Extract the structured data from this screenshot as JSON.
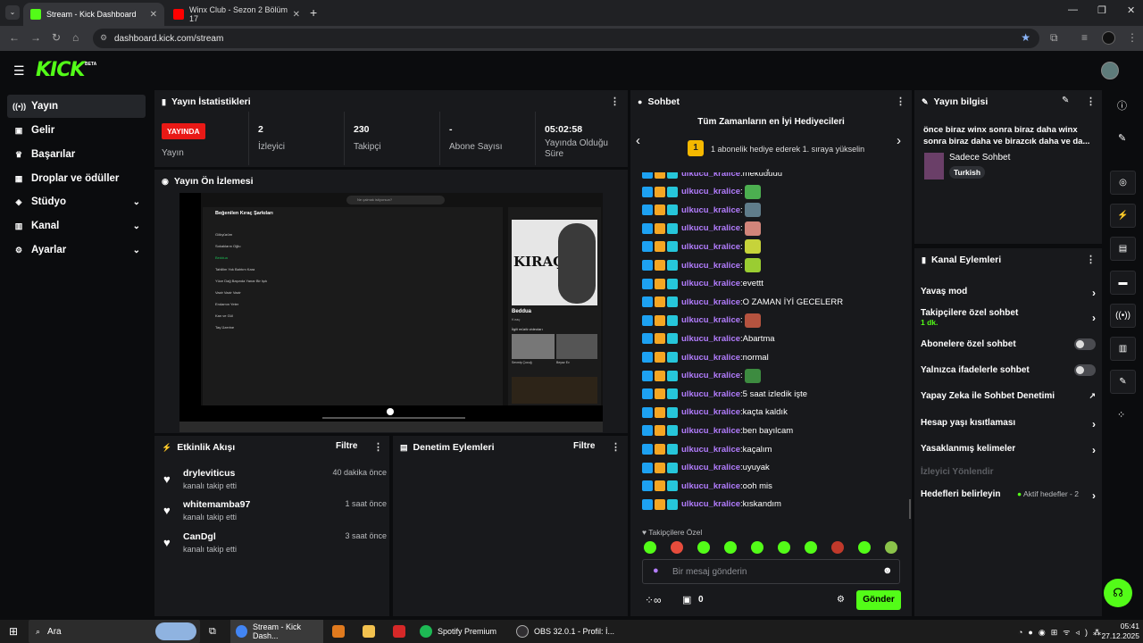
{
  "browser": {
    "tabs": [
      {
        "label": "Stream - Kick Dashboard",
        "favicon_color": "#53fc18"
      },
      {
        "label": "Winx Club - Sezon 2 Bölüm 17",
        "favicon_color": "#ff0000"
      }
    ],
    "url": "dashboard.kick.com/stream"
  },
  "logo": {
    "text": "KICK",
    "badge": "BETA"
  },
  "sidebar": {
    "items": [
      {
        "label": "Yayın",
        "icon": "broadcast-icon",
        "glyph": "((•))",
        "active": true,
        "expandable": false
      },
      {
        "label": "Gelir",
        "icon": "revenue-icon",
        "glyph": "▣",
        "active": false,
        "expandable": false
      },
      {
        "label": "Başarılar",
        "icon": "trophy-icon",
        "glyph": "🏆",
        "active": false,
        "expandable": false
      },
      {
        "label": "Droplar ve ödüller",
        "icon": "drops-icon",
        "glyph": "▦",
        "active": false,
        "expandable": false
      },
      {
        "label": "Stüdyo",
        "icon": "studio-icon",
        "glyph": "◈",
        "active": false,
        "expandable": true
      },
      {
        "label": "Kanal",
        "icon": "channel-icon",
        "glyph": "▥",
        "active": false,
        "expandable": true
      },
      {
        "label": "Ayarlar",
        "icon": "settings-icon",
        "glyph": "⚙",
        "active": false,
        "expandable": true
      }
    ]
  },
  "stats": {
    "title": "Yayın İstatistikleri",
    "live_badge": "YAYINDA",
    "live_label": "Yayın",
    "items": [
      {
        "value": "2",
        "label": "İzleyici"
      },
      {
        "value": "230",
        "label": "Takipçi"
      },
      {
        "value": "-",
        "label": "Abone Sayısı"
      },
      {
        "value": "05:02:58",
        "label": "Yayında Olduğu Süre"
      }
    ]
  },
  "preview": {
    "title": "Yayın Ön İzlemesi",
    "playlist_title": "Beğenilen Kıraç Şarkıları",
    "album_text": "KIRAÇ",
    "now_playing": "Beddua",
    "now_artist": "Kıraç",
    "search_placeholder": "Ne çalmak istiyorsun?",
    "tracks": [
      "Gökyüzüm",
      "Sokakların Oğlu",
      "Beddua",
      "Tahlilim Yok Bahtım Kara",
      "Yüce Dağ Başında Yanar Bir Işık",
      "Vazir Vazir Vazir",
      "Endamın Yeter",
      "Kan ve Gül",
      "Taş Üzerine"
    ],
    "related": [
      "Sevmiş Çocuğ",
      "Beyaz Ev"
    ],
    "related_label": "İlgili müzik videoları"
  },
  "activity": {
    "title": "Etkinlik Akışı",
    "filter": "Filtre",
    "items": [
      {
        "user": "dryleviticus",
        "action": "kanalı takip etti",
        "time": "40 dakika önce"
      },
      {
        "user": "whitemamba97",
        "action": "kanalı takip etti",
        "time": "1 saat önce"
      },
      {
        "user": "CanDgl",
        "action": "kanalı takip etti",
        "time": "3 saat önce"
      }
    ]
  },
  "moderation": {
    "title": "Denetim Eylemleri",
    "filter": "Filtre"
  },
  "chat": {
    "title": "Sohbet",
    "gifters_title": "Tüm Zamanların en İyi Hediyecileri",
    "gifters_rank": "1",
    "gifters_sub": "1 abonelik hediye ederek 1. sıraya yükselin",
    "messages": [
      {
        "user": "ulkucu_kralice",
        "text": "mekuuuuu",
        "emote": ""
      },
      {
        "user": "ulkucu_kralice",
        "text": "",
        "emote": "#4caf50"
      },
      {
        "user": "ulkucu_kralice",
        "text": "",
        "emote": "#607d8b"
      },
      {
        "user": "ulkucu_kralice",
        "text": "",
        "emote": "#d2857a"
      },
      {
        "user": "ulkucu_kralice",
        "text": "",
        "emote": "#c6d33a"
      },
      {
        "user": "ulkucu_kralice",
        "text": "",
        "emote": "#9acd32"
      },
      {
        "user": "ulkucu_kralice",
        "text": "evettt",
        "emote": ""
      },
      {
        "user": "ulkucu_kralice",
        "text": "O ZAMAN İYİ GECELERR",
        "emote": ""
      },
      {
        "user": "ulkucu_kralice",
        "text": "",
        "emote": "#b5533f"
      },
      {
        "user": "ulkucu_kralice",
        "text": "Abartma",
        "emote": ""
      },
      {
        "user": "ulkucu_kralice",
        "text": "normal",
        "emote": ""
      },
      {
        "user": "ulkucu_kralice",
        "text": "",
        "emote": "#3d8b40"
      },
      {
        "user": "ulkucu_kralice",
        "text": "5 saat izledik işte",
        "emote": ""
      },
      {
        "user": "ulkucu_kralice",
        "text": "kaçta kaldık",
        "emote": ""
      },
      {
        "user": "ulkucu_kralice",
        "text": "ben bayılcam",
        "emote": ""
      },
      {
        "user": "ulkucu_kralice",
        "text": "kaçalım",
        "emote": ""
      },
      {
        "user": "ulkucu_kralice",
        "text": "uyuyak",
        "emote": ""
      },
      {
        "user": "ulkucu_kralice",
        "text": "ooh mis",
        "emote": ""
      },
      {
        "user": "ulkucu_kralice",
        "text": "kıskandım",
        "emote": ""
      }
    ],
    "followers_only_label": "Takipçilere Özel",
    "input_placeholder": "Bir mesaj gönderin",
    "points": "0",
    "send_label": "Gönder"
  },
  "stream_info": {
    "title": "Yayın bilgisi",
    "stream_title": "önce biraz winx sonra biraz daha winx sonra biraz daha ve birazcık daha ve da...",
    "category": "Sadece Sohbet",
    "language_tag": "Turkish"
  },
  "channel_actions": {
    "title": "Kanal Eylemleri",
    "items": [
      {
        "label": "Yavaş mod",
        "control": "chevron"
      },
      {
        "label": "Takipçilere özel sohbet",
        "sub": "1 dk.",
        "control": "chevron"
      },
      {
        "label": "Abonelere özel sohbet",
        "control": "toggle"
      },
      {
        "label": "Yalnızca ifadelerle sohbet",
        "control": "toggle"
      },
      {
        "label": "Yapay Zeka ile Sohbet Denetimi",
        "control": "external"
      },
      {
        "label": "Hesap yaşı kısıtlaması",
        "control": "chevron"
      },
      {
        "label": "Yasaklanmış kelimeler",
        "control": "chevron"
      },
      {
        "label": "İzleyici Yönlendir",
        "control": "none",
        "disabled": true
      },
      {
        "label": "Hedefleri belirleyin",
        "status": "Aktif hedefler - 2",
        "control": "chevron"
      }
    ]
  },
  "taskbar": {
    "search_label": "Ara",
    "apps": [
      {
        "label": "Stream - Kick Dash...",
        "color": "#4285f4"
      },
      {
        "label": "Spotify Premium",
        "color": "#1db954"
      },
      {
        "label": "OBS 32.0.1 - Profil: İ...",
        "color": "#302e31"
      }
    ],
    "time": "05:41",
    "date": "27.12.2025"
  },
  "colors": {
    "accent": "#53fc18",
    "live": "#e91916",
    "panel": "#18191c",
    "username": "#b37dff"
  }
}
